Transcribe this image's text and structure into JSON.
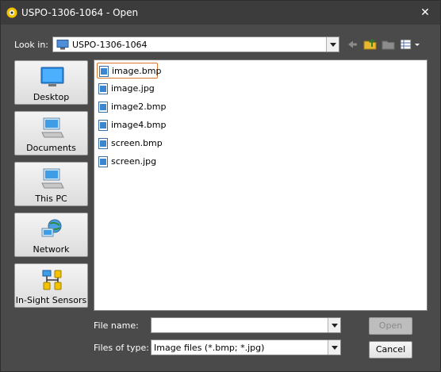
{
  "window": {
    "title": "USPO-1306-1064 - Open",
    "close_glyph": "✕"
  },
  "lookin": {
    "label": "Look in:",
    "value": "USPO-1306-1064",
    "icon": "computer-icon"
  },
  "toolbar": [
    {
      "name": "back-icon"
    },
    {
      "name": "up-folder-icon"
    },
    {
      "name": "new-folder-icon"
    },
    {
      "name": "view-menu-icon"
    }
  ],
  "places": [
    {
      "label": "Desktop",
      "icon": "desktop-icon"
    },
    {
      "label": "Documents",
      "icon": "documents-icon"
    },
    {
      "label": "This PC",
      "icon": "this-pc-icon"
    },
    {
      "label": "Network",
      "icon": "network-icon"
    },
    {
      "label": "In-Sight Sensors",
      "icon": "in-sight-sensors-icon"
    }
  ],
  "files": [
    {
      "name": "image.bmp",
      "selected": true
    },
    {
      "name": "image.jpg",
      "selected": false
    },
    {
      "name": "image2.bmp",
      "selected": false
    },
    {
      "name": "image4.bmp",
      "selected": false
    },
    {
      "name": "screen.bmp",
      "selected": false
    },
    {
      "name": "screen.jpg",
      "selected": false
    }
  ],
  "filename": {
    "label": "File name:",
    "value": ""
  },
  "filetype": {
    "label": "Files of type:",
    "value": "Image files (*.bmp; *.jpg)"
  },
  "buttons": {
    "open": "Open",
    "cancel": "Cancel"
  },
  "colors": {
    "window_bg": "#4a4a4a",
    "selection_border": "#d9772f"
  }
}
